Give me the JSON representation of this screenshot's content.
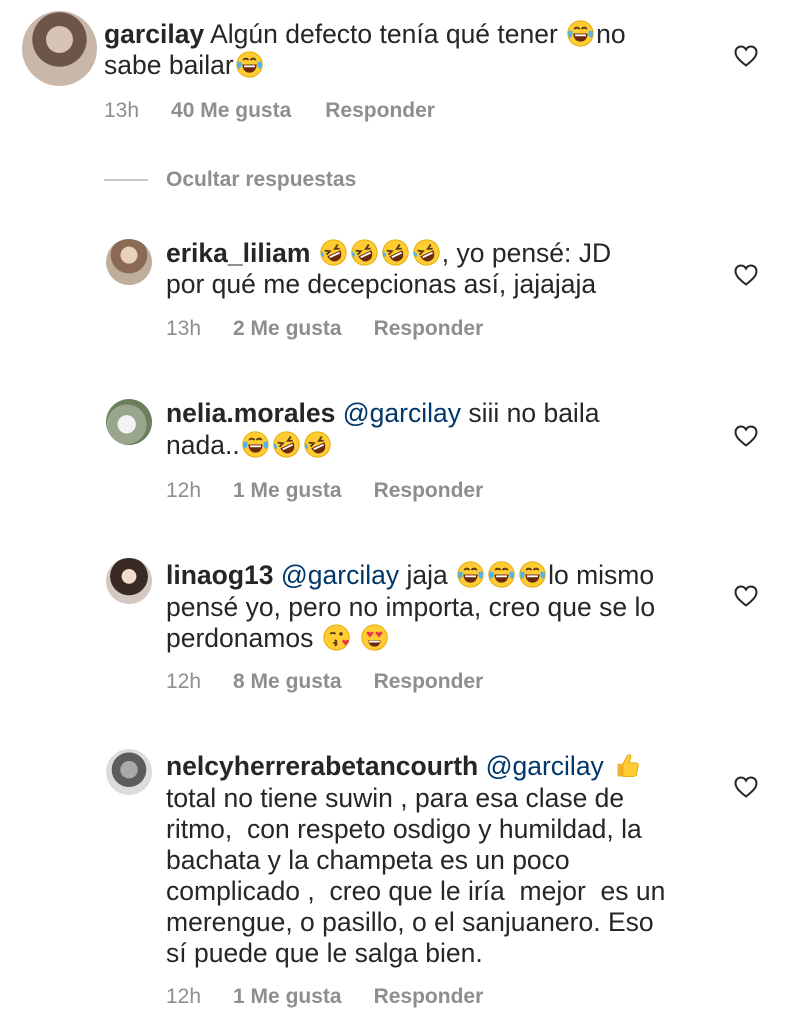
{
  "hide_replies_label": "Ocultar respuestas",
  "comments": [
    {
      "username": "garcilay",
      "line1_text": "Algún defecto tenía qué tener ",
      "line1_after": "no",
      "line2_text": "sabe bailar",
      "time": "13h",
      "likes": "40 Me gusta",
      "reply": "Responder",
      "avatar_icon": "avatar-garcilay"
    },
    {
      "username": "erika_liliam",
      "line1_after": ", yo pensé: JD",
      "line2_text": "por qué me decepcionas así, jajajaja",
      "time": "13h",
      "likes": "2 Me gusta",
      "reply": "Responder",
      "avatar_icon": "avatar-erika"
    },
    {
      "username": "nelia.morales",
      "mention": "@garcilay",
      "line1_after": " siii no baila",
      "line2_text": "nada..",
      "time": "12h",
      "likes": "1 Me gusta",
      "reply": "Responder",
      "avatar_icon": "avatar-nelia"
    },
    {
      "username": "linaog13",
      "mention": "@garcilay",
      "line1_after": " jaja ",
      "line1_end": "lo mismo",
      "line2_text": "pensé yo, pero no importa, creo que se lo",
      "line3_text": "perdonamos ",
      "time": "12h",
      "likes": "8 Me gusta",
      "reply": "Responder",
      "avatar_icon": "avatar-lina"
    },
    {
      "username": "nelcyherrerabetancourth",
      "mention": "@garcilay",
      "lines": [
        "total no tiene suwin , para esa clase de",
        "ritmo,  con respeto osdigo y humildad, la",
        "bachata y la champeta es un poco",
        "complicado ,  creo que le iría  mejor  es un",
        "merengue, o pasillo, o el sanjuanero. Eso",
        "sí puede que le salga bien."
      ],
      "time": "12h",
      "likes": "1 Me gusta",
      "reply": "Responder",
      "avatar_icon": "avatar-nelcy"
    }
  ],
  "icons": {
    "like": "heart-outline-icon",
    "laugh": "face-with-tears-of-joy-emoji",
    "rofl": "rolling-on-floor-laughing-emoji",
    "kiss": "face-blowing-kiss-emoji",
    "hearteyes": "smiling-face-with-heart-eyes-emoji",
    "thumbsup": "thumbs-up-emoji"
  },
  "colors": {
    "text": "#262626",
    "meta": "#8e8e8e",
    "mention": "#00376b"
  }
}
